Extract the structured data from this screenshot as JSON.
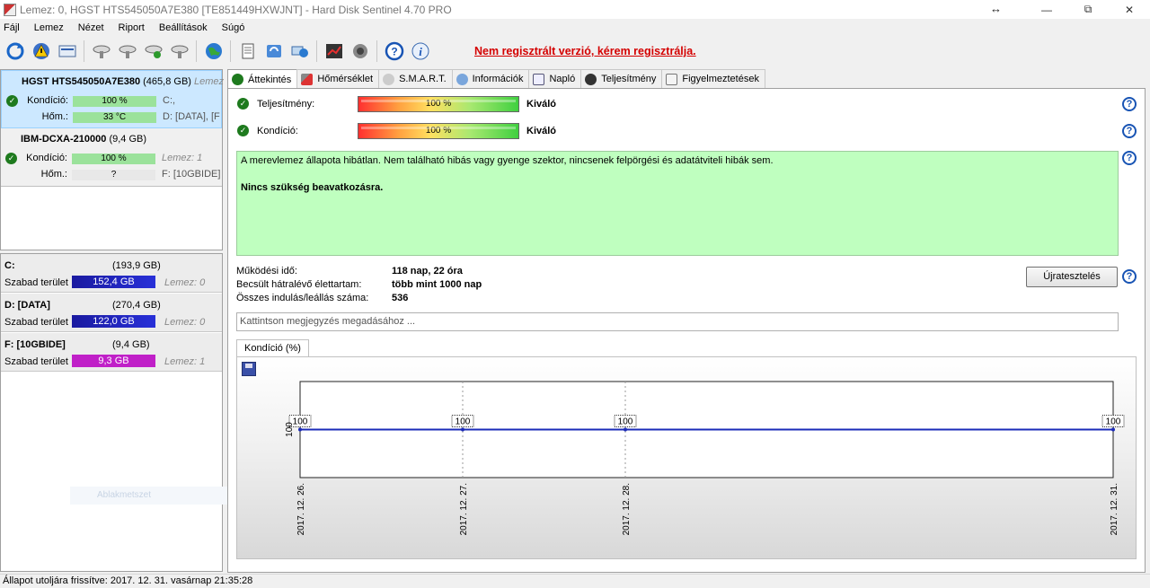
{
  "window": {
    "title": "Lemez: 0, HGST HTS545050A7E380 [TE851449HXWJNT]  -  Hard Disk Sentinel 4.70 PRO",
    "resize_glyph": "↔",
    "minimize": "—",
    "maximize": "☐",
    "restore": "⧉",
    "close": "✕"
  },
  "menu": [
    "Fájl",
    "Lemez",
    "Nézet",
    "Riport",
    "Beállítások",
    "Súgó"
  ],
  "toolbar": {
    "icons": [
      "refresh-icon",
      "warning-icon",
      "disk-panel-icon",
      "hdd-1-icon",
      "hdd-2-icon",
      "hdd-3-icon",
      "hdd-4-icon",
      "globe-icon",
      "document-icon",
      "sync-icon",
      "network-icon",
      "chart-icon",
      "speaker-icon",
      "help-icon",
      "info-icon"
    ],
    "unregistered_text": "Nem regisztrált verzió, kérem regisztrálja."
  },
  "disks": [
    {
      "name": "HGST HTS545050A7E380",
      "size": "(465,8 GB)",
      "extra": "Lemez",
      "condition_label": "Kondíció:",
      "condition_value": "100 %",
      "condition_extra": "C:,",
      "temp_label": "Hőm.:",
      "temp_value": "33 °C",
      "temp_extra": "D: [DATA],  [F"
    },
    {
      "name": "IBM-DCXA-210000",
      "size": "(9,4 GB)",
      "condition_label": "Kondíció:",
      "condition_value": "100 %",
      "condition_extra": "Lemez: 1",
      "temp_label": "Hőm.:",
      "temp_value": "?",
      "temp_extra": "F: [10GBIDE]"
    }
  ],
  "volumes": [
    {
      "name": "C:",
      "size": "(193,9 GB)",
      "free_label": "Szabad terület",
      "free_value": "152,4 GB",
      "disk": "Lemez: 0"
    },
    {
      "name": "D: [DATA]",
      "size": "(270,4 GB)",
      "free_label": "Szabad terület",
      "free_value": "122,0 GB",
      "disk": "Lemez: 0"
    },
    {
      "name": "F: [10GBIDE]",
      "size": "(9,4 GB)",
      "free_label": "Szabad terület",
      "free_value": "9,3 GB",
      "disk": "Lemez: 1"
    }
  ],
  "ghost_label": "Ablakmetszet",
  "tabs": [
    "Áttekintés",
    "Hőmérséklet",
    "S.M.A.R.T.",
    "Információk",
    "Napló",
    "Teljesítmény",
    "Figyelmeztetések"
  ],
  "overview": {
    "performance_label": "Teljesítmény:",
    "performance_value": "100 %",
    "performance_rating": "Kiváló",
    "condition_label": "Kondíció:",
    "condition_value": "100 %",
    "condition_rating": "Kiváló",
    "status_text": "A merevlemez állapota hibátlan. Nem található hibás vagy gyenge szektor, nincsenek felpörgési és adatátviteli hibák sem.",
    "status_action": "Nincs szükség beavatkozásra.",
    "uptime_label": "Működési idő:",
    "uptime_value": "118 nap, 22 óra",
    "lifetime_label": "Becsült hátralévő élettartam:",
    "lifetime_value": "több mint 1000 nap",
    "starts_label": "Összes indulás/leállás száma:",
    "starts_value": "536",
    "retest_button": "Újratesztelés",
    "help_glyph": "?",
    "note_placeholder": "Kattintson megjegyzés megadásához ...",
    "chart_tab": "Kondíció  (%)"
  },
  "chart_data": {
    "type": "line",
    "x": [
      "2017. 12. 26.",
      "2017. 12. 27.",
      "2017. 12. 28.",
      "2017. 12. 31."
    ],
    "series": [
      {
        "values": [
          100,
          100,
          100,
          100
        ]
      }
    ],
    "ytick": "100",
    "line_color": "#1b2bb8"
  },
  "statusbar": "Állapot utoljára frissítve: 2017. 12. 31. vasárnap 21:35:28"
}
